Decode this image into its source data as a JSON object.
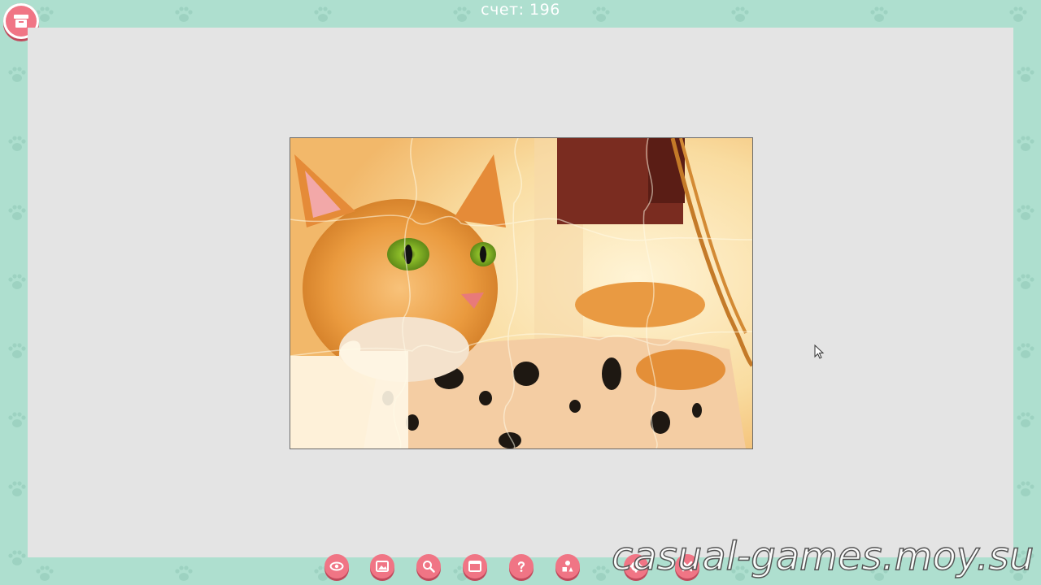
{
  "header": {
    "score_text": "счет: 196"
  },
  "colors": {
    "frame": "#aedfcf",
    "board": "#e4e4e4",
    "button": "#f07585",
    "button_shadow": "#c04a5c"
  },
  "puzzle": {
    "image_subject": "ginger cat in leopard-print basket",
    "pieces_cols": 5,
    "pieces_rows": 4
  },
  "corner_button": {
    "icon": "box-icon"
  },
  "toolbar": {
    "buttons": [
      {
        "name": "preview-button",
        "icon": "eye-icon"
      },
      {
        "name": "image-button",
        "icon": "image-icon"
      },
      {
        "name": "zoom-button",
        "icon": "magnifier-icon"
      },
      {
        "name": "fullscreen-button",
        "icon": "window-icon"
      },
      {
        "name": "help-button",
        "icon": "question-icon"
      },
      {
        "name": "pieces-button",
        "icon": "shapes-icon"
      },
      {
        "name": "settings-button",
        "icon": "gear-icon"
      },
      {
        "name": "exit-button",
        "icon": "close-icon"
      }
    ]
  },
  "watermark": "casual-games.moy.su"
}
